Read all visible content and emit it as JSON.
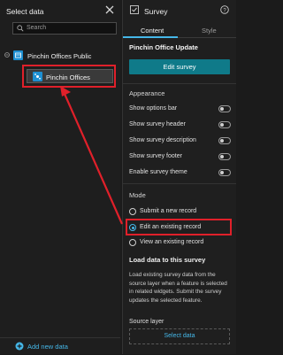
{
  "left_panel": {
    "title": "Select data",
    "search_placeholder": "Search",
    "tree": {
      "parent_label": "Pinchin Offices Public",
      "child_label": "Pinchin Offices"
    },
    "footer_add_label": "Add new data"
  },
  "right_panel": {
    "title": "Survey",
    "tabs": [
      "Content",
      "Style"
    ],
    "form_name": "Pinchin Office Update",
    "edit_button": "Edit survey",
    "appearance": {
      "title": "Appearance",
      "toggles": [
        {
          "label": "Show options bar"
        },
        {
          "label": "Show survey header"
        },
        {
          "label": "Show survey description"
        },
        {
          "label": "Show survey footer"
        },
        {
          "label": "Enable survey theme"
        }
      ]
    },
    "mode": {
      "title": "Mode",
      "options": [
        {
          "label": "Submit a new record",
          "selected": false
        },
        {
          "label": "Edit an existing record",
          "selected": true
        },
        {
          "label": "View an existing record",
          "selected": false
        }
      ]
    },
    "load": {
      "title": "Load data to this survey",
      "description": "Load existing survey data from the source layer when a feature is selected in related widgets. Submit the survey updates the selected feature.",
      "source_label": "Source layer",
      "select_label": "Select data"
    }
  },
  "colors": {
    "accent": "#45b7e8",
    "button": "#0f7a89",
    "highlight": "#e0202a",
    "layer_icon": "#1d8fd1"
  }
}
